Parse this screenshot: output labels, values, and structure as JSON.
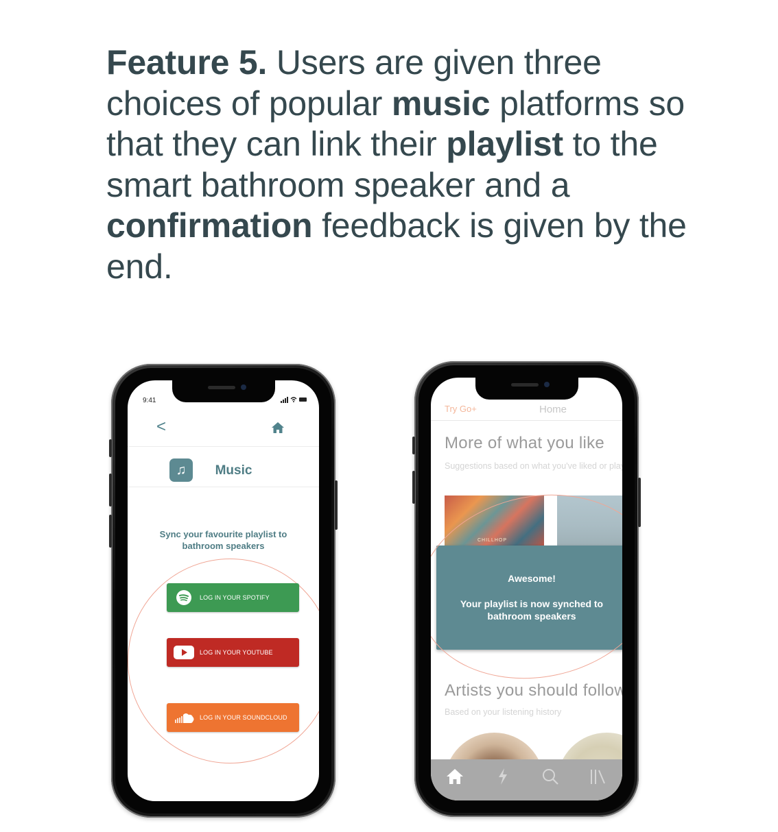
{
  "caption": {
    "prefix_bold": "Feature 5.",
    "part1": " Users are given three choices of popular ",
    "bold1": "music",
    "part2": " platforms so that they can link their ",
    "bold2": "playlist",
    "part3": " to the smart bathroom speaker and a ",
    "bold3": "confirmation",
    "part4": " feedback is given by the end."
  },
  "phone1": {
    "status_time": "9:41",
    "back_glyph": "<",
    "page_title": "Music",
    "sync_text": "Sync your favourite playlist to bathroom speakers",
    "buttons": [
      {
        "label": "LOG IN YOUR SPOTIFY",
        "icon": "spotify-icon",
        "color": "#3d9a53"
      },
      {
        "label": "LOG IN YOUR YOUTUBE",
        "icon": "youtube-icon",
        "color": "#bf2a24"
      },
      {
        "label": "LOG IN YOUR SOUNDCLOUD",
        "icon": "soundcloud-icon",
        "color": "#ee7431"
      }
    ],
    "accent_color": "#5d8a92"
  },
  "phone2": {
    "try_go": "Try Go+",
    "home_tab": "Home",
    "section1_title": "More of what you like",
    "section1_sub": "Suggestions based on what you've liked or played",
    "album1_label": "CHILLHOP",
    "dialog_title": "Awesome!",
    "dialog_message": "Your playlist is now synched to bathroom speakers",
    "section2_title": "Artists you should follow",
    "section2_sub": "Based on your listening history",
    "tabs": [
      "home-icon",
      "stream-icon",
      "search-icon",
      "library-icon"
    ],
    "dialog_color": "#5e8a92"
  }
}
